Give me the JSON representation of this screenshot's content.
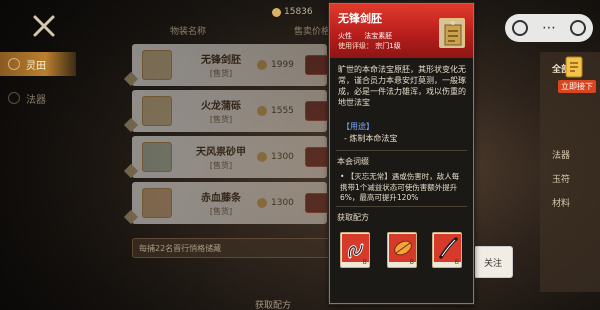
{
  "topbar": {
    "currency_value": "15836"
  },
  "columns": {
    "name": "物装名称",
    "price": "售卖价格"
  },
  "tabs": [
    {
      "label": "灵田",
      "active": true
    },
    {
      "label": "法器",
      "active": false
    }
  ],
  "list": [
    {
      "name": "无锋剑胚",
      "tag": "[售货]",
      "price": "1999"
    },
    {
      "name": "火龙蒲砾",
      "tag": "[售货]",
      "price": "1555"
    },
    {
      "name": "天风祟砂甲",
      "tag": "[售货]",
      "price": "1300"
    },
    {
      "name": "赤血藤条",
      "tag": "[售货]",
      "price": "1300"
    }
  ],
  "hint_text": "每捕22名晋行悄格储藏",
  "bottom_label": "获取配方",
  "right_panel": {
    "items": [
      "全部",
      "法器",
      "玉符",
      "材料"
    ],
    "badge": "立即接下"
  },
  "popup": {
    "title": "无锋剑胚",
    "attr_label": "火性",
    "type_label": "法宝素胚",
    "level_label": "使用评级：",
    "level_value": "宗门1级",
    "description": "旷世的本命法宝原胚，其形状变化无常，谨合员力本悬安灯莫测，一般琢成，必是一件法力雄浑，戏以伤重的地世法宝",
    "usage_title": "【用途】",
    "usage_item": "- 炼制本命法宝",
    "affix_title": "本会词缀",
    "affix_text": "• 【灭忘无常】遇或伤害时，敌人每携带1个减益状态可使伤害额外提升6%，最高可提升120%",
    "recipe_title": "获取配方",
    "recipes": [
      {
        "name": "recipe-serpent-icon",
        "count": "8"
      },
      {
        "name": "recipe-flame-icon",
        "count": "8"
      },
      {
        "name": "recipe-blade-icon",
        "count": "8"
      }
    ]
  },
  "follow_label": "关注"
}
